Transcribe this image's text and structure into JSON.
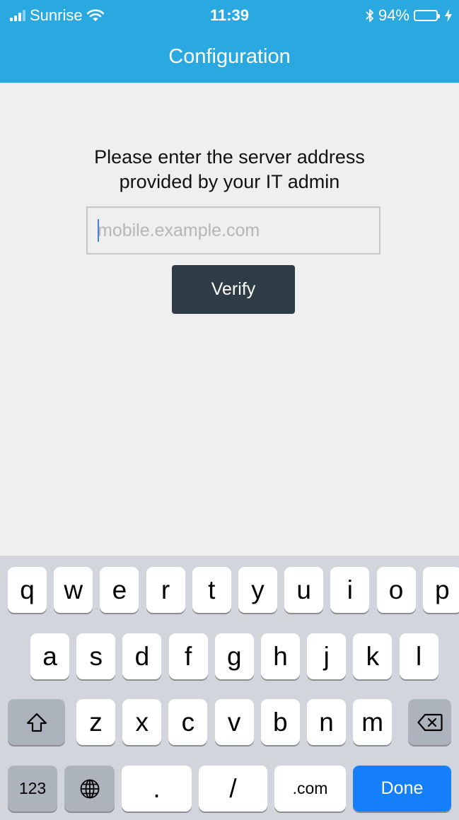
{
  "status_bar": {
    "carrier": "Sunrise",
    "time": "11:39",
    "battery_percent": "94%",
    "battery_level": 0.94,
    "battery_color": "#4cd964",
    "icons": [
      "signal-icon",
      "wifi-icon",
      "bluetooth-icon",
      "battery-icon",
      "charging-icon"
    ]
  },
  "header": {
    "title": "Configuration",
    "background_color": "#29a9e0"
  },
  "main": {
    "prompt_line1": "Please enter the server address",
    "prompt_line2": "provided by your IT admin",
    "server_input": {
      "value": "",
      "placeholder": "mobile.example.com"
    },
    "verify_label": "Verify",
    "verify_color": "#2e3c46"
  },
  "keyboard": {
    "row1": [
      "q",
      "w",
      "e",
      "r",
      "t",
      "y",
      "u",
      "i",
      "o",
      "p"
    ],
    "row2": [
      "a",
      "s",
      "d",
      "f",
      "g",
      "h",
      "j",
      "k",
      "l"
    ],
    "row3": [
      "z",
      "x",
      "c",
      "v",
      "b",
      "n",
      "m"
    ],
    "shift_icon": "shift-icon",
    "backspace_icon": "backspace-icon",
    "numbers_label": "123",
    "globe_icon": "globe-icon",
    "period_label": ".",
    "slash_label": "/",
    "dotcom_label": ".com",
    "done_label": "Done",
    "done_color": "#147efb"
  }
}
